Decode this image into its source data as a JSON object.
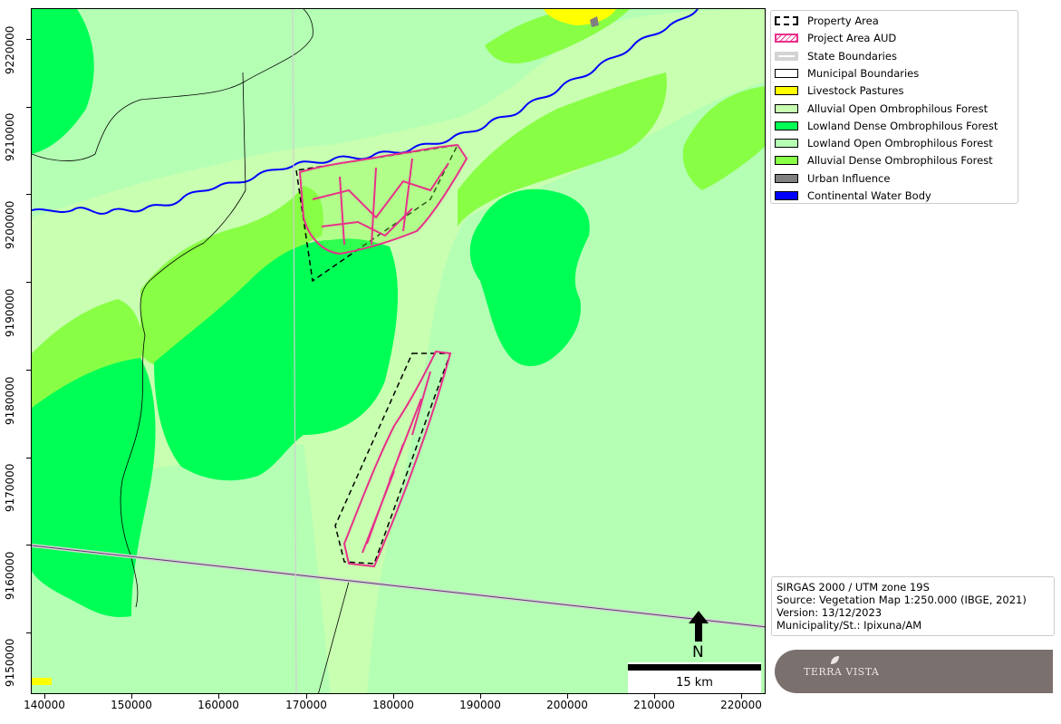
{
  "map": {
    "x_ticks": [
      "140000",
      "150000",
      "160000",
      "170000",
      "180000",
      "190000",
      "200000",
      "210000",
      "220000"
    ],
    "y_ticks": [
      "9220000",
      "9210000",
      "9200000",
      "9190000",
      "9180000",
      "9170000",
      "9160000",
      "9150000"
    ],
    "north_label": "N",
    "scale_label": "15 km"
  },
  "legend": {
    "items": [
      {
        "label": "Property Area",
        "style": "dashed",
        "fill": "#ffffff",
        "stroke": "#000000"
      },
      {
        "label": "Project Area AUD",
        "style": "hatch",
        "fill": "#ffffff",
        "stroke": "#e8308a"
      },
      {
        "label": "State Boundaries",
        "style": "thick",
        "fill": "#ffffff",
        "stroke": "#d3d3d3"
      },
      {
        "label": "Municipal Boundaries",
        "style": "solid",
        "fill": "#ffffff",
        "stroke": "#000000"
      },
      {
        "label": "Livestock Pastures",
        "style": "solid",
        "fill": "#ffff00",
        "stroke": "#000000"
      },
      {
        "label": "Alluvial Open Ombrophilous Forest",
        "style": "solid",
        "fill": "#c8ffb0",
        "stroke": "#000000"
      },
      {
        "label": "Lowland Dense Ombrophilous Forest",
        "style": "solid",
        "fill": "#00ff55",
        "stroke": "#000000"
      },
      {
        "label": "Lowland Open Ombrophilous Forest",
        "style": "solid",
        "fill": "#b4ffb4",
        "stroke": "#000000"
      },
      {
        "label": "Alluvial Dense Ombrophilous Forest",
        "style": "solid",
        "fill": "#88ff44",
        "stroke": "#000000"
      },
      {
        "label": "Urban Influence",
        "style": "solid",
        "fill": "#808080",
        "stroke": "#000000"
      },
      {
        "label": "Continental Water Body",
        "style": "solid",
        "fill": "#0000ff",
        "stroke": "#000000"
      }
    ]
  },
  "info": {
    "lines": [
      "SIRGAS 2000 / UTM zone 19S",
      "Source: Vegetation Map 1:250.000 (IBGE, 2021)",
      "Version: 13/12/2023",
      "Municipality/St.: Ipixuna/AM"
    ]
  },
  "logo": {
    "text": "TERRA VISTA"
  },
  "colors": {
    "lowland_open": "#b4ffb4",
    "lowland_dense": "#00ff55",
    "alluvial_open": "#c8ffb0",
    "alluvial_dense": "#88ff44",
    "pasture": "#ffff00",
    "urban": "#808080",
    "water": "#0000ff",
    "project": "#e8308a"
  }
}
